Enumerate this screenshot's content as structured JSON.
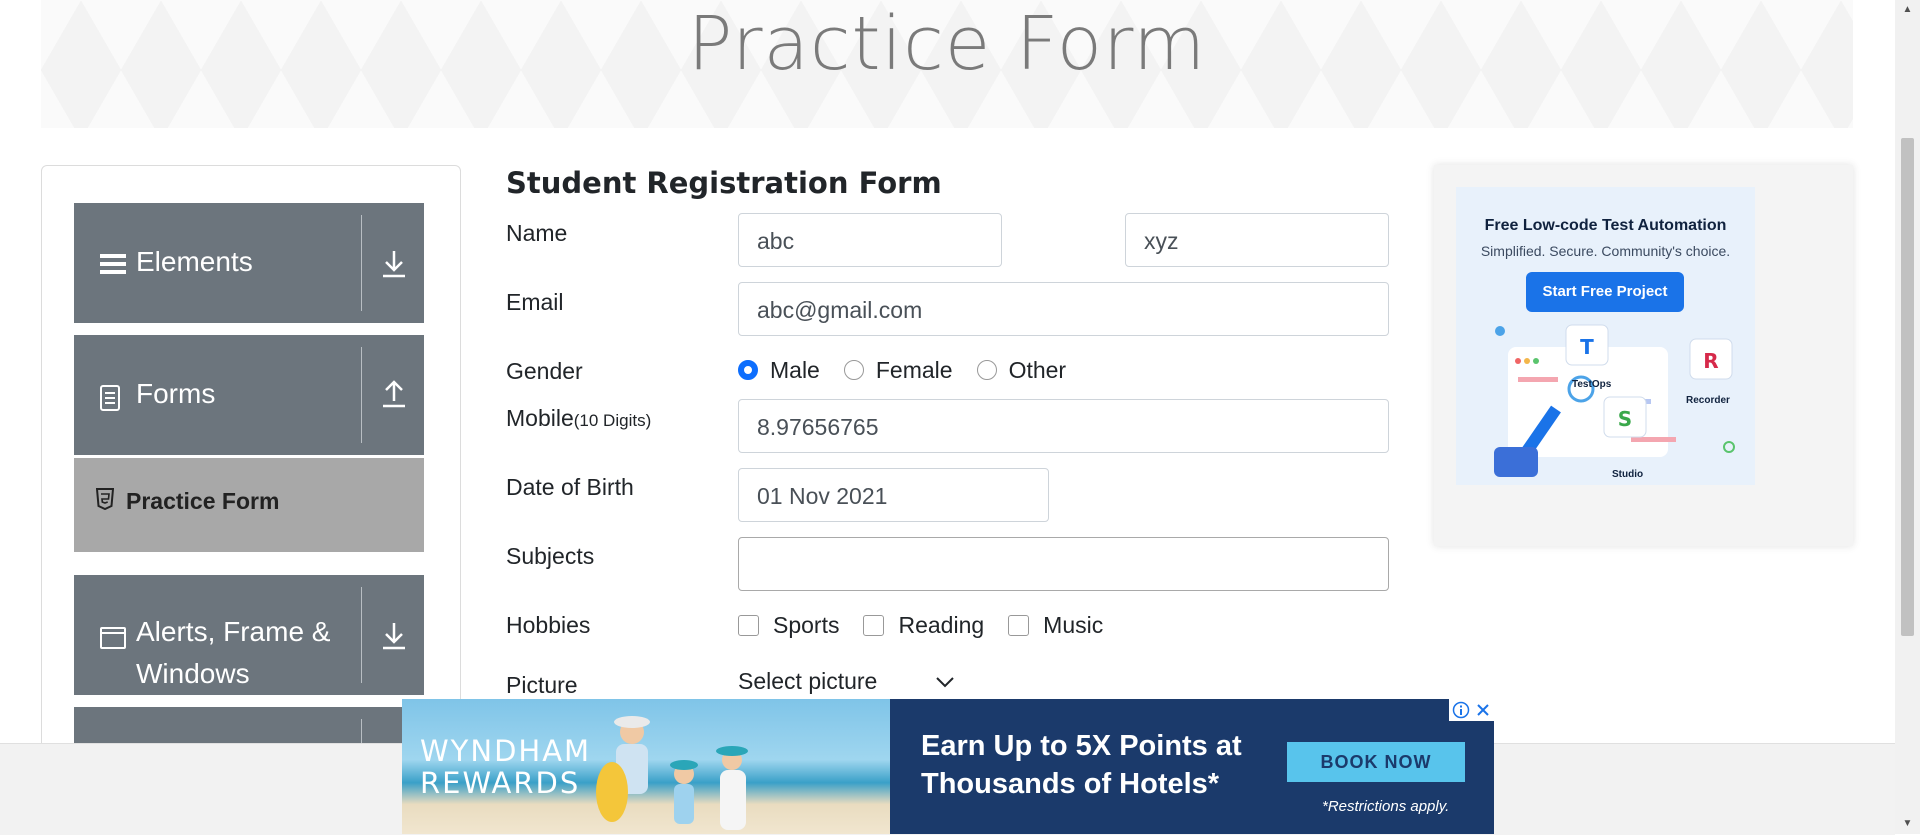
{
  "header": {
    "title": "Practice Form"
  },
  "sidebar": {
    "groups": [
      {
        "label": "Elements",
        "icon": "hamburger-icon",
        "arrow": "download-arrow-icon"
      },
      {
        "label": "Forms",
        "icon": "document-icon",
        "arrow": "upload-arrow-icon"
      },
      {
        "label_line1": "Alerts, Frame &",
        "label_line2": "Windows",
        "icon": "window-icon",
        "arrow": "download-arrow-icon"
      }
    ],
    "active_item": {
      "label": "Practice Form",
      "icon": "html5-icon"
    }
  },
  "form": {
    "title": "Student Registration Form",
    "name_label": "Name",
    "first_name": "abc",
    "last_name": "xyz",
    "email_label": "Email",
    "email": "abc@gmail.com",
    "gender_label": "Gender",
    "gender_options": [
      "Male",
      "Female",
      "Other"
    ],
    "gender_selected": "Male",
    "mobile_label": "Mobile",
    "mobile_hint": "(10 Digits)",
    "mobile": "8.97656765",
    "dob_label": "Date of Birth",
    "dob": "01 Nov 2021",
    "subjects_label": "Subjects",
    "subjects": "",
    "hobbies_label": "Hobbies",
    "hobbies": [
      "Sports",
      "Reading",
      "Music"
    ],
    "picture_label": "Picture",
    "picture_select": "Select picture"
  },
  "ad_right": {
    "headline": "Free Low-code Test Automation",
    "subline": "Simplified. Secure. Community's choice.",
    "button": "Start Free Project",
    "products": [
      "TestOps",
      "Recorder",
      "Studio"
    ]
  },
  "ad_bottom": {
    "brand_line1": "WYNDHAM",
    "brand_line2": "REWARDS",
    "headline_line1": "Earn Up to 5X Points at",
    "headline_line2": "Thousands of Hotels*",
    "button": "BOOK NOW",
    "note": "*Restrictions apply."
  },
  "colors": {
    "sidebar_group": "#6c757d",
    "active_item": "#a8a8a8",
    "radio_selected": "#0d6efd",
    "ad_blue": "#1b3a6b"
  }
}
